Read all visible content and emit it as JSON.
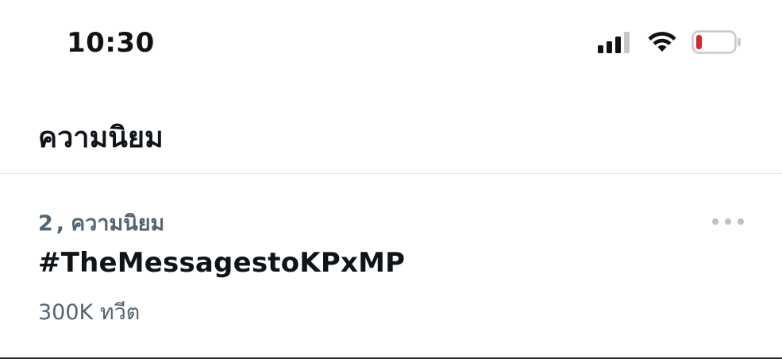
{
  "status_bar": {
    "time": "10:30",
    "icons": [
      "cellular-signal-icon",
      "wifi-icon",
      "battery-icon"
    ],
    "battery_color": "#e0242b"
  },
  "header": {
    "title": "ความนิยม"
  },
  "trend": {
    "rank": "2",
    "separator": ",",
    "category": "ความนิยม",
    "name": "#TheMessagestoKPxMP",
    "count": "300K ทวีต",
    "more_icon": "more-horizontal-icon"
  },
  "colors": {
    "text_primary": "#0f1419",
    "text_secondary": "#536471",
    "divider": "#e1e6ea"
  }
}
